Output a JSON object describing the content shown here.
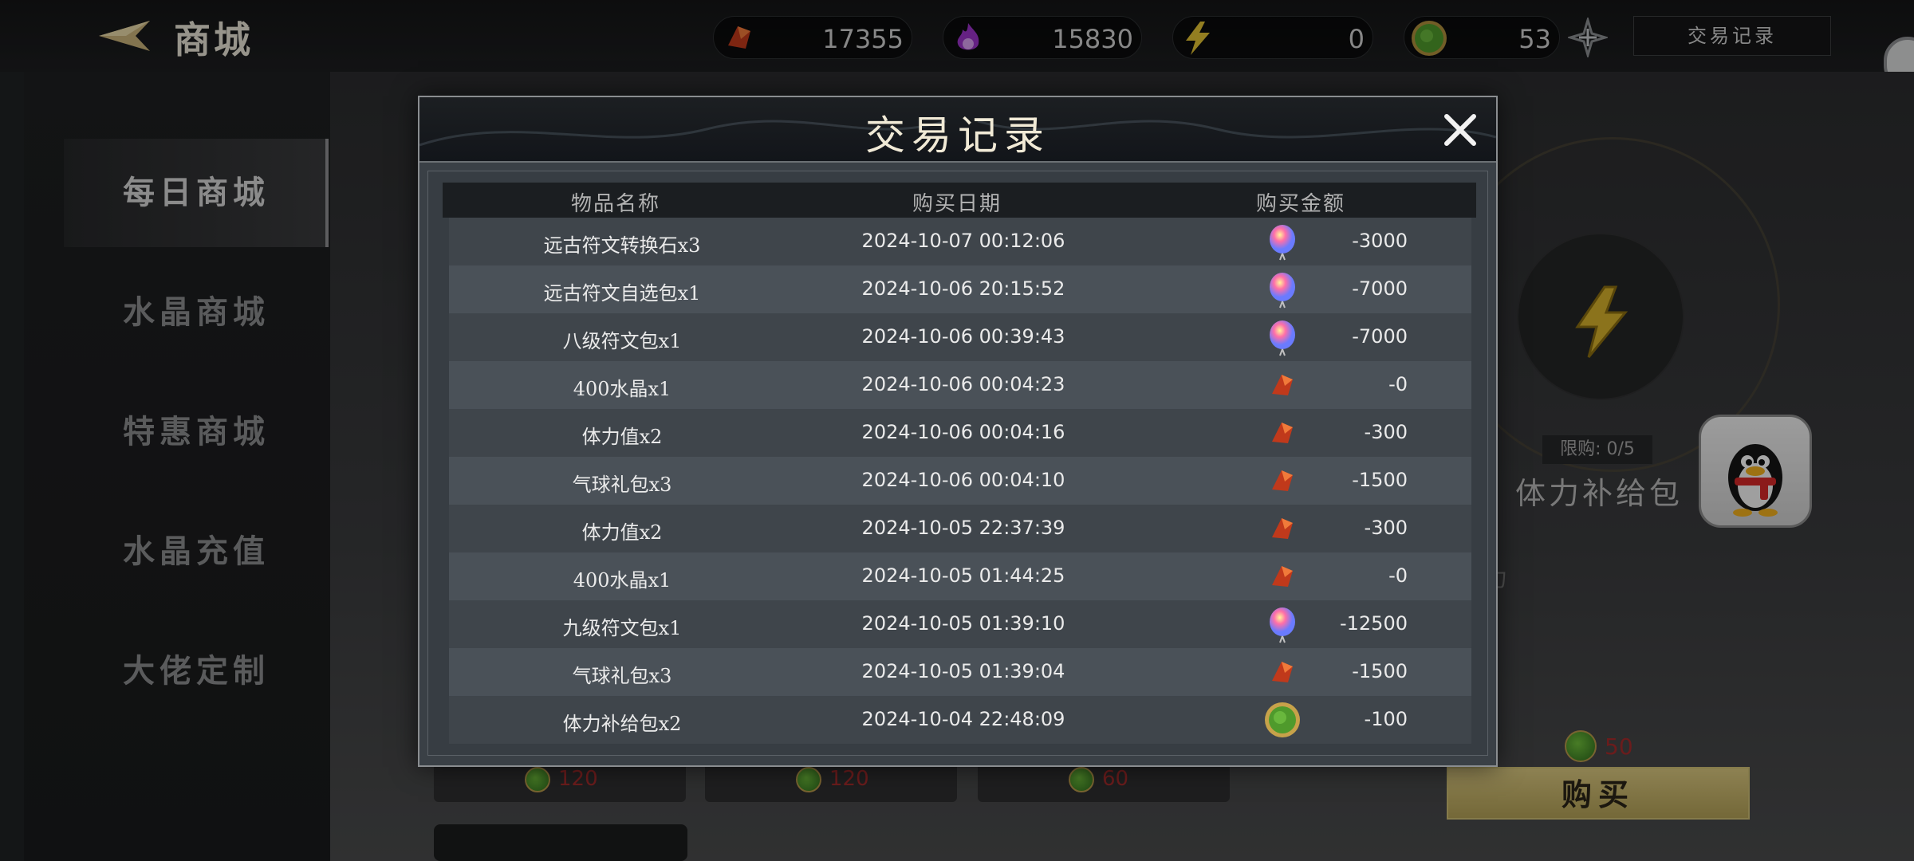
{
  "header": {
    "title": "商城",
    "currencies": [
      {
        "icon": "red-crystal-icon",
        "value": "17355"
      },
      {
        "icon": "purple-flame-icon",
        "value": "15830"
      },
      {
        "icon": "lightning-icon",
        "value": "0"
      },
      {
        "icon": "green-coin-icon",
        "value": "53"
      }
    ],
    "record_button": "交易记录"
  },
  "sidebar": {
    "items": [
      {
        "label": "每日商城",
        "active": true
      },
      {
        "label": "水晶商城",
        "active": false
      },
      {
        "label": "特惠商城",
        "active": false
      },
      {
        "label": "水晶充值",
        "active": false
      },
      {
        "label": "大佬定制",
        "active": false
      }
    ]
  },
  "shop_cards": [
    {
      "price": "120"
    },
    {
      "price": "120"
    },
    {
      "price": "60"
    }
  ],
  "product": {
    "limit": "限购: 0/5",
    "name": "体力补给包",
    "faded_text": "力",
    "price": "50",
    "buy_label": "购买"
  },
  "modal": {
    "title": "交易记录",
    "columns": [
      "物品名称",
      "购买日期",
      "购买金额"
    ],
    "records": [
      {
        "name": "远古符文转换石x3",
        "date": "2024-10-07 00:12:06",
        "currency": "balloon",
        "amount": "-3000"
      },
      {
        "name": "远古符文自选包x1",
        "date": "2024-10-06 20:15:52",
        "currency": "balloon",
        "amount": "-7000"
      },
      {
        "name": "八级符文包x1",
        "date": "2024-10-06 00:39:43",
        "currency": "balloon",
        "amount": "-7000"
      },
      {
        "name": "400水晶x1",
        "date": "2024-10-06 00:04:23",
        "currency": "crystal",
        "amount": "-0"
      },
      {
        "name": "体力值x2",
        "date": "2024-10-06 00:04:16",
        "currency": "crystal",
        "amount": "-300"
      },
      {
        "name": "气球礼包x3",
        "date": "2024-10-06 00:04:10",
        "currency": "crystal",
        "amount": "-1500"
      },
      {
        "name": "体力值x2",
        "date": "2024-10-05 22:37:39",
        "currency": "crystal",
        "amount": "-300"
      },
      {
        "name": "400水晶x1",
        "date": "2024-10-05 01:44:25",
        "currency": "crystal",
        "amount": "-0"
      },
      {
        "name": "九级符文包x1",
        "date": "2024-10-05 01:39:10",
        "currency": "balloon",
        "amount": "-12500"
      },
      {
        "name": "气球礼包x3",
        "date": "2024-10-05 01:39:04",
        "currency": "crystal",
        "amount": "-1500"
      },
      {
        "name": "体力补给包x2",
        "date": "2024-10-04 22:48:09",
        "currency": "green-coin",
        "amount": "-100"
      }
    ]
  }
}
